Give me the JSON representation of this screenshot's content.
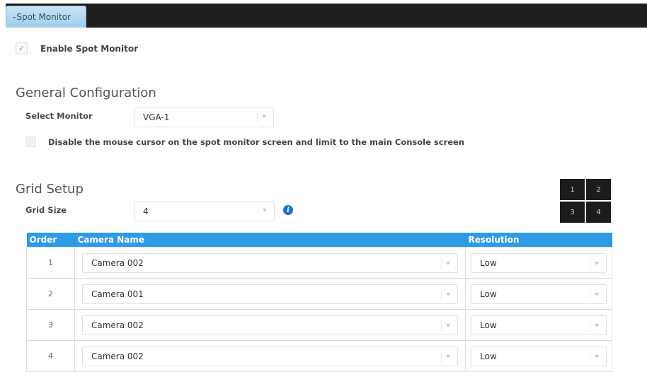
{
  "tab": {
    "label": "Spot Monitor",
    "prefix": "-"
  },
  "enable": {
    "label": "Enable Spot Monitor",
    "checked": true
  },
  "general": {
    "title": "General Configuration",
    "select_monitor_label": "Select Monitor",
    "select_monitor_value": "VGA-1",
    "disable_cursor_label": "Disable the mouse cursor on the spot monitor screen and limit to the main Console screen",
    "disable_cursor_checked": false
  },
  "grid": {
    "title": "Grid Setup",
    "grid_size_label": "Grid Size",
    "grid_size_value": "4",
    "layout_cells": [
      "1",
      "2",
      "3",
      "4"
    ],
    "table": {
      "headers": {
        "order": "Order",
        "camera": "Camera Name",
        "resolution": "Resolution"
      },
      "rows": [
        {
          "order": "1",
          "camera": "Camera 002",
          "resolution": "Low"
        },
        {
          "order": "2",
          "camera": "Camera 001",
          "resolution": "Low"
        },
        {
          "order": "3",
          "camera": "Camera 002",
          "resolution": "Low"
        },
        {
          "order": "4",
          "camera": "Camera 002",
          "resolution": "Low"
        }
      ]
    }
  },
  "colors": {
    "tab_bar": "#1e1e1e",
    "tab": "#9fcdeb",
    "table_header": "#2e9be6",
    "info_icon": "#1f73c7"
  }
}
